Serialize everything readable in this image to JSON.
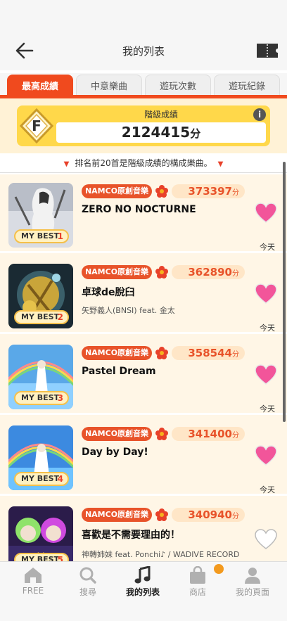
{
  "header": {
    "title": "我的列表"
  },
  "tabs": [
    {
      "label": "最高成績",
      "active": true
    },
    {
      "label": "中意樂曲",
      "active": false
    },
    {
      "label": "遊玩次數",
      "active": false
    },
    {
      "label": "遊玩紀錄",
      "active": false
    }
  ],
  "grade": {
    "badge": "F",
    "label": "階級成績",
    "score": "2124415",
    "unit": "分"
  },
  "notice": "排名前20首是階級成績的構成樂曲。",
  "songs": [
    {
      "rank": "1",
      "category": "NAMCO原創音樂",
      "score": "373397",
      "unit": "分",
      "title": "ZERO NO NOCTURNE",
      "artist": "",
      "date": "今天",
      "favorite": true
    },
    {
      "rank": "2",
      "category": "NAMCO原創音樂",
      "score": "362890",
      "unit": "分",
      "title": "卓球de脫臼",
      "artist": "矢野義人(BNSI) feat. 金太",
      "date": "今天",
      "favorite": true
    },
    {
      "rank": "3",
      "category": "NAMCO原創音樂",
      "score": "358544",
      "unit": "分",
      "title": "Pastel Dream",
      "artist": "",
      "date": "今天",
      "favorite": true
    },
    {
      "rank": "4",
      "category": "NAMCO原創音樂",
      "score": "341400",
      "unit": "分",
      "title": "Day by Day!",
      "artist": "",
      "date": "今天",
      "favorite": true
    },
    {
      "rank": "5",
      "category": "NAMCO原創音樂",
      "score": "340940",
      "unit": "分",
      "title": "喜歡是不需要理由的！",
      "artist": "神轉姉妹 feat. Ponchi♪ / WADIVE RECORD",
      "date": "",
      "favorite": false
    }
  ],
  "myBestLabel": "MY BEST",
  "nav": [
    {
      "label": "FREE",
      "icon": "home-icon",
      "active": false
    },
    {
      "label": "搜尋",
      "icon": "search-icon",
      "active": false
    },
    {
      "label": "我的列表",
      "icon": "music-note-icon",
      "active": true
    },
    {
      "label": "商店",
      "icon": "shopping-bag-icon",
      "active": false
    },
    {
      "label": "我的頁面",
      "icon": "user-icon",
      "active": false
    }
  ],
  "colors": {
    "accent": "#f04a1e",
    "heart": "#f2559a",
    "gold": "#ffd84a"
  }
}
